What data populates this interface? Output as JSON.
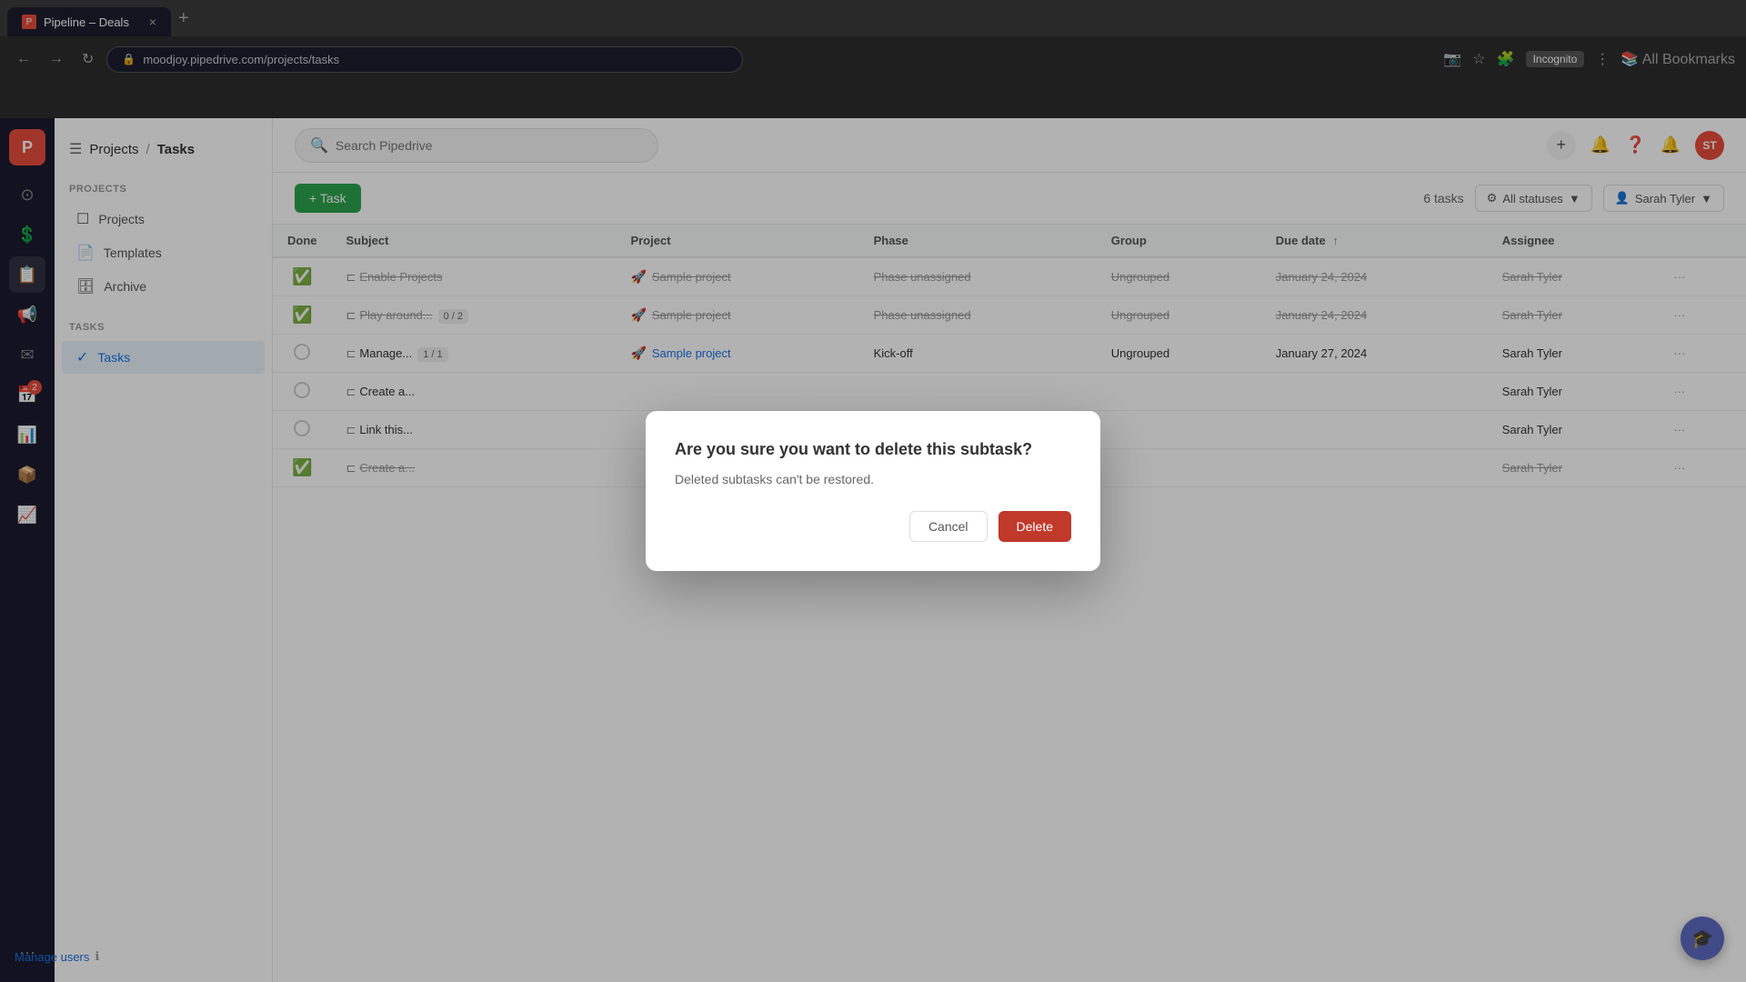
{
  "browser": {
    "tab_title": "Pipeline – Deals",
    "tab_close": "×",
    "new_tab": "+",
    "address": "moodjoy.pipedrive.com/projects/tasks",
    "incognito_label": "Incognito"
  },
  "header": {
    "breadcrumb_parent": "Projects",
    "breadcrumb_separator": "/",
    "breadcrumb_current": "Tasks",
    "search_placeholder": "Search Pipedrive",
    "add_label": "+",
    "user_initials": "ST"
  },
  "sidebar": {
    "section_projects": "PROJECTS",
    "section_tasks": "TASKS",
    "projects_label": "Projects",
    "templates_label": "Templates",
    "archive_label": "Archive",
    "tasks_label": "Tasks",
    "manage_users_label": "Manage users"
  },
  "toolbar": {
    "add_task_label": "+ Task",
    "task_count": "6 tasks",
    "filter_label": "All statuses",
    "user_filter_label": "Sarah Tyler"
  },
  "table": {
    "columns": [
      "Done",
      "Subject",
      "Project",
      "Phase",
      "Group",
      "Due date",
      "Assignee"
    ],
    "rows": [
      {
        "done": true,
        "subject": "Enable Projects",
        "subtask_badge": "",
        "project": "Sample project",
        "phase": "Phase unassigned",
        "group": "Ungrouped",
        "due_date": "January 24, 2024",
        "assignee": "Sarah Tyler",
        "strikethrough": true
      },
      {
        "done": true,
        "subject": "Play around...",
        "subtask_badge": "0 / 2",
        "project": "Sample project",
        "phase": "Phase unassigned",
        "group": "Ungrouped",
        "due_date": "January 24, 2024",
        "assignee": "Sarah Tyler",
        "strikethrough": true
      },
      {
        "done": false,
        "subject": "Manage...",
        "subtask_badge": "1 / 1",
        "project": "Sample project",
        "phase": "Kick-off",
        "group": "Ungrouped",
        "due_date": "January 27, 2024",
        "assignee": "Sarah Tyler",
        "strikethrough": false
      },
      {
        "done": false,
        "subject": "Create a...",
        "subtask_badge": "",
        "project": "",
        "phase": "",
        "group": "",
        "due_date": "",
        "assignee": "Sarah Tyler",
        "strikethrough": false
      },
      {
        "done": false,
        "subject": "Link this...",
        "subtask_badge": "",
        "project": "",
        "phase": "",
        "group": "",
        "due_date": "",
        "assignee": "Sarah Tyler",
        "strikethrough": false
      },
      {
        "done": true,
        "subject": "Create a...",
        "subtask_badge": "",
        "project": "",
        "phase": "",
        "group": "",
        "due_date": "",
        "assignee": "Sarah Tyler",
        "strikethrough": true
      }
    ]
  },
  "modal": {
    "title": "Are you sure you want to delete this subtask?",
    "body": "Deleted subtasks can't be restored.",
    "cancel_label": "Cancel",
    "delete_label": "Delete"
  },
  "help_fab": "🎓",
  "rail_icons": [
    "●",
    "💲",
    "📋",
    "📢",
    "✉",
    "2",
    "📅",
    "📊",
    "📦",
    "📈",
    "⋯"
  ]
}
